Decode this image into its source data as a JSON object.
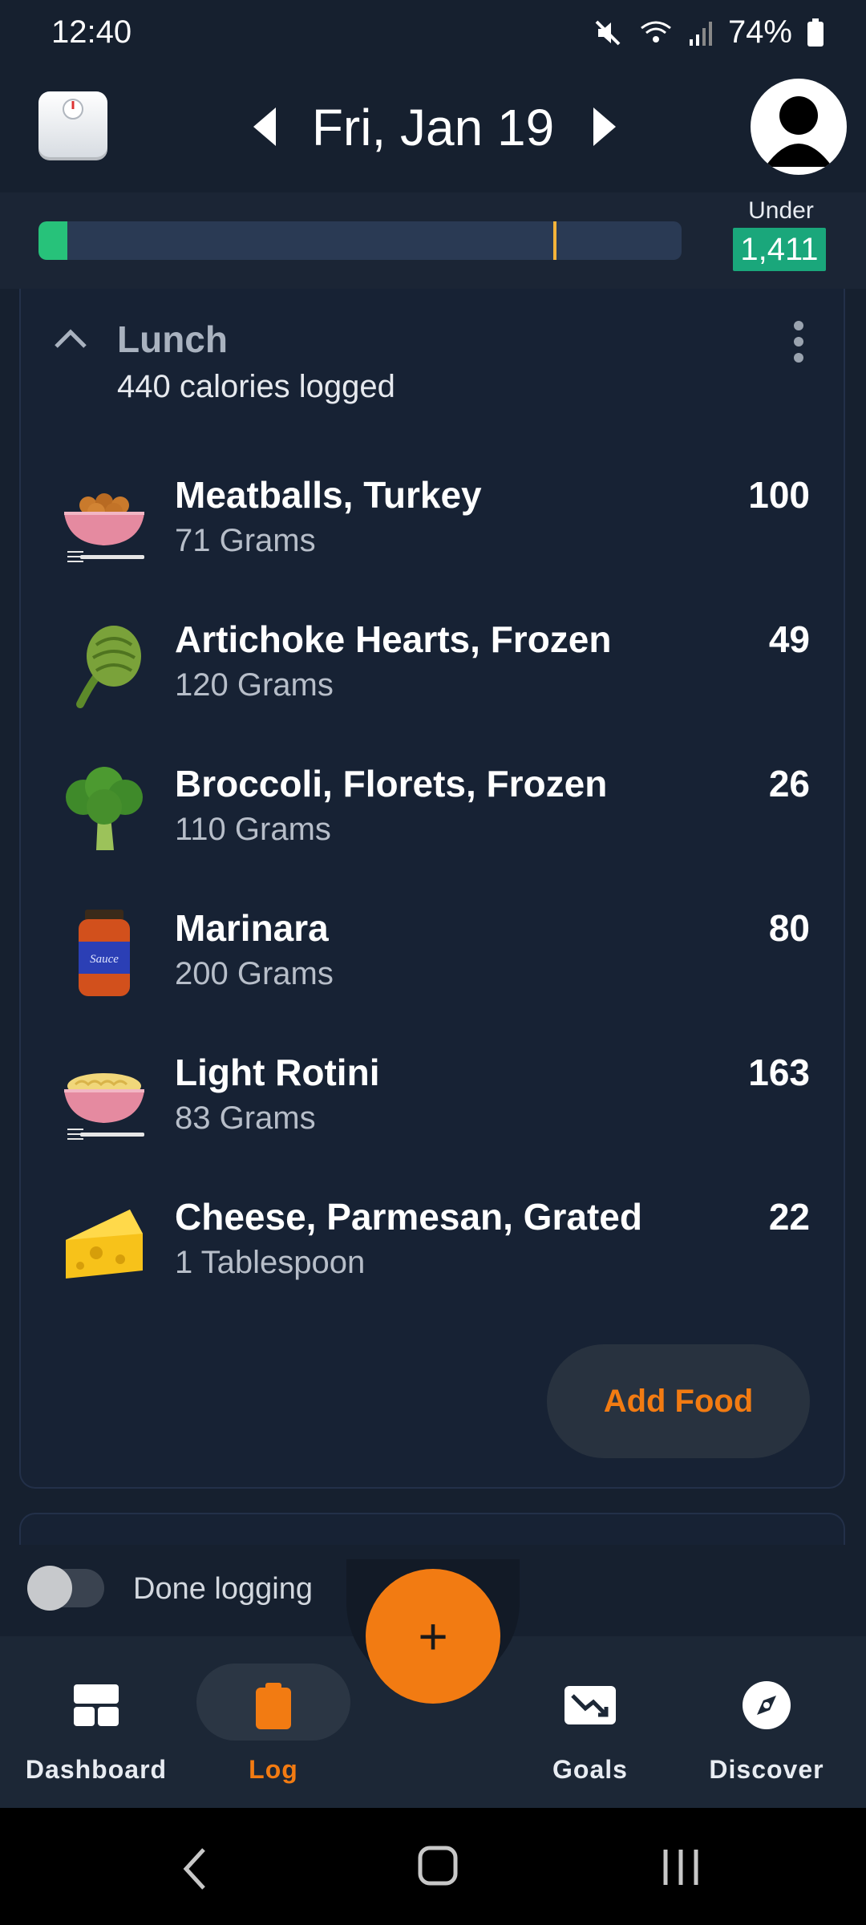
{
  "status_bar": {
    "time": "12:40",
    "battery": "74%"
  },
  "header": {
    "date": "Fri, Jan 19"
  },
  "budget": {
    "under_label": "Under",
    "under_value": "1,411",
    "progress_fraction": 0.045,
    "goal_marker_fraction": 0.8,
    "colors": {
      "fill": "#27c27a",
      "marker": "#f5b33a"
    }
  },
  "meal": {
    "title": "Lunch",
    "subtitle": "440 calories logged",
    "items": [
      {
        "name": "Meatballs, Turkey",
        "qty": "71 Grams",
        "calories": "100",
        "icon": "meatball-bowl-icon"
      },
      {
        "name": "Artichoke Hearts, Frozen",
        "qty": "120 Grams",
        "calories": "49",
        "icon": "artichoke-icon"
      },
      {
        "name": "Broccoli, Florets, Frozen",
        "qty": "110 Grams",
        "calories": "26",
        "icon": "broccoli-icon"
      },
      {
        "name": "Marinara",
        "qty": "200 Grams",
        "calories": "80",
        "icon": "sauce-jar-icon"
      },
      {
        "name": "Light Rotini",
        "qty": "83 Grams",
        "calories": "163",
        "icon": "pasta-bowl-icon"
      },
      {
        "name": "Cheese, Parmesan, Grated",
        "qty": "1 Tablespoon",
        "calories": "22",
        "icon": "cheese-icon"
      }
    ],
    "add_food_label": "Add Food",
    "sauce_label": "Sauce"
  },
  "done_logging": {
    "label": "Done logging"
  },
  "fab": {
    "symbol": "+"
  },
  "nav": [
    {
      "label": "Dashboard",
      "icon": "dashboard-icon"
    },
    {
      "label": "Log",
      "icon": "clipboard-icon"
    },
    {
      "label": "Goals",
      "icon": "trend-down-icon"
    },
    {
      "label": "Discover",
      "icon": "compass-icon"
    }
  ],
  "accent_color": "#f27b12"
}
